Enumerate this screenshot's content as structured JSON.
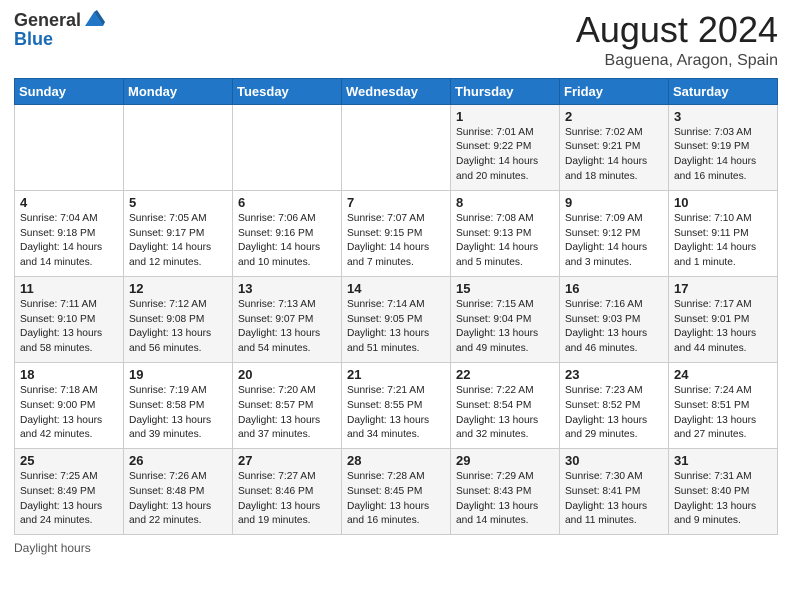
{
  "header": {
    "logo_general": "General",
    "logo_blue": "Blue",
    "title": "August 2024",
    "subtitle": "Baguena, Aragon, Spain"
  },
  "calendar": {
    "days_of_week": [
      "Sunday",
      "Monday",
      "Tuesday",
      "Wednesday",
      "Thursday",
      "Friday",
      "Saturday"
    ],
    "weeks": [
      [
        {
          "day": "",
          "sunrise": "",
          "sunset": "",
          "daylight": ""
        },
        {
          "day": "",
          "sunrise": "",
          "sunset": "",
          "daylight": ""
        },
        {
          "day": "",
          "sunrise": "",
          "sunset": "",
          "daylight": ""
        },
        {
          "day": "",
          "sunrise": "",
          "sunset": "",
          "daylight": ""
        },
        {
          "day": "1",
          "sunrise": "Sunrise: 7:01 AM",
          "sunset": "Sunset: 9:22 PM",
          "daylight": "Daylight: 14 hours and 20 minutes."
        },
        {
          "day": "2",
          "sunrise": "Sunrise: 7:02 AM",
          "sunset": "Sunset: 9:21 PM",
          "daylight": "Daylight: 14 hours and 18 minutes."
        },
        {
          "day": "3",
          "sunrise": "Sunrise: 7:03 AM",
          "sunset": "Sunset: 9:19 PM",
          "daylight": "Daylight: 14 hours and 16 minutes."
        }
      ],
      [
        {
          "day": "4",
          "sunrise": "Sunrise: 7:04 AM",
          "sunset": "Sunset: 9:18 PM",
          "daylight": "Daylight: 14 hours and 14 minutes."
        },
        {
          "day": "5",
          "sunrise": "Sunrise: 7:05 AM",
          "sunset": "Sunset: 9:17 PM",
          "daylight": "Daylight: 14 hours and 12 minutes."
        },
        {
          "day": "6",
          "sunrise": "Sunrise: 7:06 AM",
          "sunset": "Sunset: 9:16 PM",
          "daylight": "Daylight: 14 hours and 10 minutes."
        },
        {
          "day": "7",
          "sunrise": "Sunrise: 7:07 AM",
          "sunset": "Sunset: 9:15 PM",
          "daylight": "Daylight: 14 hours and 7 minutes."
        },
        {
          "day": "8",
          "sunrise": "Sunrise: 7:08 AM",
          "sunset": "Sunset: 9:13 PM",
          "daylight": "Daylight: 14 hours and 5 minutes."
        },
        {
          "day": "9",
          "sunrise": "Sunrise: 7:09 AM",
          "sunset": "Sunset: 9:12 PM",
          "daylight": "Daylight: 14 hours and 3 minutes."
        },
        {
          "day": "10",
          "sunrise": "Sunrise: 7:10 AM",
          "sunset": "Sunset: 9:11 PM",
          "daylight": "Daylight: 14 hours and 1 minute."
        }
      ],
      [
        {
          "day": "11",
          "sunrise": "Sunrise: 7:11 AM",
          "sunset": "Sunset: 9:10 PM",
          "daylight": "Daylight: 13 hours and 58 minutes."
        },
        {
          "day": "12",
          "sunrise": "Sunrise: 7:12 AM",
          "sunset": "Sunset: 9:08 PM",
          "daylight": "Daylight: 13 hours and 56 minutes."
        },
        {
          "day": "13",
          "sunrise": "Sunrise: 7:13 AM",
          "sunset": "Sunset: 9:07 PM",
          "daylight": "Daylight: 13 hours and 54 minutes."
        },
        {
          "day": "14",
          "sunrise": "Sunrise: 7:14 AM",
          "sunset": "Sunset: 9:05 PM",
          "daylight": "Daylight: 13 hours and 51 minutes."
        },
        {
          "day": "15",
          "sunrise": "Sunrise: 7:15 AM",
          "sunset": "Sunset: 9:04 PM",
          "daylight": "Daylight: 13 hours and 49 minutes."
        },
        {
          "day": "16",
          "sunrise": "Sunrise: 7:16 AM",
          "sunset": "Sunset: 9:03 PM",
          "daylight": "Daylight: 13 hours and 46 minutes."
        },
        {
          "day": "17",
          "sunrise": "Sunrise: 7:17 AM",
          "sunset": "Sunset: 9:01 PM",
          "daylight": "Daylight: 13 hours and 44 minutes."
        }
      ],
      [
        {
          "day": "18",
          "sunrise": "Sunrise: 7:18 AM",
          "sunset": "Sunset: 9:00 PM",
          "daylight": "Daylight: 13 hours and 42 minutes."
        },
        {
          "day": "19",
          "sunrise": "Sunrise: 7:19 AM",
          "sunset": "Sunset: 8:58 PM",
          "daylight": "Daylight: 13 hours and 39 minutes."
        },
        {
          "day": "20",
          "sunrise": "Sunrise: 7:20 AM",
          "sunset": "Sunset: 8:57 PM",
          "daylight": "Daylight: 13 hours and 37 minutes."
        },
        {
          "day": "21",
          "sunrise": "Sunrise: 7:21 AM",
          "sunset": "Sunset: 8:55 PM",
          "daylight": "Daylight: 13 hours and 34 minutes."
        },
        {
          "day": "22",
          "sunrise": "Sunrise: 7:22 AM",
          "sunset": "Sunset: 8:54 PM",
          "daylight": "Daylight: 13 hours and 32 minutes."
        },
        {
          "day": "23",
          "sunrise": "Sunrise: 7:23 AM",
          "sunset": "Sunset: 8:52 PM",
          "daylight": "Daylight: 13 hours and 29 minutes."
        },
        {
          "day": "24",
          "sunrise": "Sunrise: 7:24 AM",
          "sunset": "Sunset: 8:51 PM",
          "daylight": "Daylight: 13 hours and 27 minutes."
        }
      ],
      [
        {
          "day": "25",
          "sunrise": "Sunrise: 7:25 AM",
          "sunset": "Sunset: 8:49 PM",
          "daylight": "Daylight: 13 hours and 24 minutes."
        },
        {
          "day": "26",
          "sunrise": "Sunrise: 7:26 AM",
          "sunset": "Sunset: 8:48 PM",
          "daylight": "Daylight: 13 hours and 22 minutes."
        },
        {
          "day": "27",
          "sunrise": "Sunrise: 7:27 AM",
          "sunset": "Sunset: 8:46 PM",
          "daylight": "Daylight: 13 hours and 19 minutes."
        },
        {
          "day": "28",
          "sunrise": "Sunrise: 7:28 AM",
          "sunset": "Sunset: 8:45 PM",
          "daylight": "Daylight: 13 hours and 16 minutes."
        },
        {
          "day": "29",
          "sunrise": "Sunrise: 7:29 AM",
          "sunset": "Sunset: 8:43 PM",
          "daylight": "Daylight: 13 hours and 14 minutes."
        },
        {
          "day": "30",
          "sunrise": "Sunrise: 7:30 AM",
          "sunset": "Sunset: 8:41 PM",
          "daylight": "Daylight: 13 hours and 11 minutes."
        },
        {
          "day": "31",
          "sunrise": "Sunrise: 7:31 AM",
          "sunset": "Sunset: 8:40 PM",
          "daylight": "Daylight: 13 hours and 9 minutes."
        }
      ]
    ]
  },
  "footer": {
    "daylight_label": "Daylight hours"
  }
}
